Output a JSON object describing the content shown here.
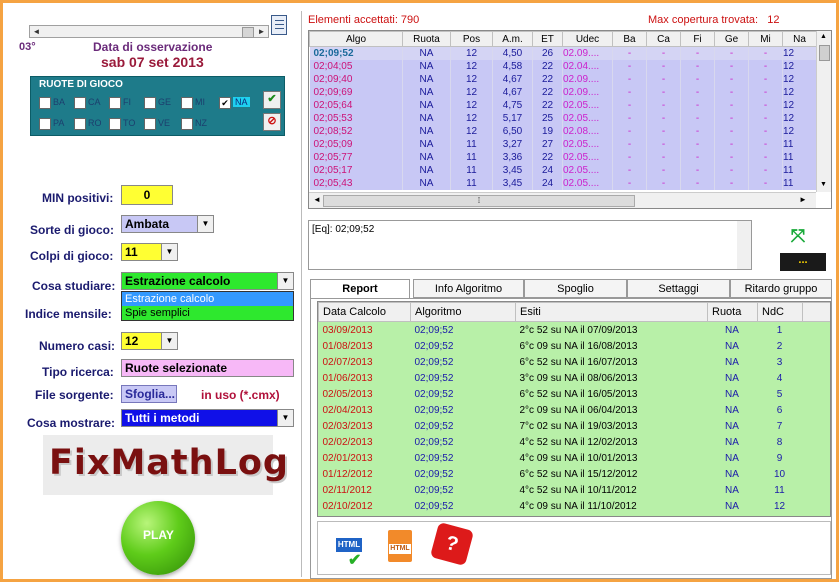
{
  "left": {
    "issue": "03°",
    "date_label": "Data di osservazione",
    "date_value": "sab 07 set 2013",
    "ruote_title": "RUOTE DI GIOCO",
    "ruote_row1": [
      "BA",
      "CA",
      "FI",
      "GE",
      "MI",
      "NA"
    ],
    "ruote_row2": [
      "PA",
      "RO",
      "TO",
      "VE",
      "NZ"
    ],
    "min_positivi_label": "MIN positivi:",
    "min_positivi_value": "0",
    "sorte_label": "Sorte di gioco:",
    "sorte_value": "Ambata",
    "colpi_label": "Colpi di gioco:",
    "colpi_value": "11",
    "cosa_studiare_label": "Cosa studiare:",
    "cosa_studiare_value": "Estrazione calcolo",
    "cosa_studiare_options": [
      "Estrazione calcolo",
      "Spie semplici"
    ],
    "indice_label": "Indice mensile:",
    "numero_casi_label": "Numero casi:",
    "numero_casi_value": "12",
    "tipo_ricerca_label": "Tipo ricerca:",
    "tipo_ricerca_value": "Ruote selezionate",
    "file_label": "File sorgente:",
    "file_button": "Sfoglia...",
    "file_status": "in uso (*.cmx)",
    "mostrare_label": "Cosa mostrare:",
    "mostrare_value": "Tutti i metodi",
    "logo_text": "FixMathLog",
    "play_label": "PLAY"
  },
  "top": {
    "accepted": "Elementi accettati: 790",
    "max_cov": "Max copertura trovata:   12",
    "columns": [
      "Algo",
      "Ruota",
      "Pos",
      "A.m.",
      "ET",
      "Udec",
      "Ba",
      "Ca",
      "Fi",
      "Ge",
      "Mi",
      "Na"
    ],
    "rows": [
      [
        "02;09;52",
        "NA",
        "12",
        "4,50",
        "26",
        "02.09...."
      ],
      [
        "02;04;05",
        "NA",
        "12",
        "4,58",
        "22",
        "02.04...."
      ],
      [
        "02;09;40",
        "NA",
        "12",
        "4,67",
        "22",
        "02.09...."
      ],
      [
        "02;09;69",
        "NA",
        "12",
        "4,67",
        "22",
        "02.09...."
      ],
      [
        "02;05;64",
        "NA",
        "12",
        "4,75",
        "22",
        "02.05...."
      ],
      [
        "02;05;53",
        "NA",
        "12",
        "5,17",
        "25",
        "02.05...."
      ],
      [
        "02;08;52",
        "NA",
        "12",
        "6,50",
        "19",
        "02.08...."
      ],
      [
        "02;05;09",
        "NA",
        "11",
        "3,27",
        "27",
        "02.05...."
      ],
      [
        "02;05;77",
        "NA",
        "11",
        "3,36",
        "22",
        "02.05...."
      ],
      [
        "02;05;17",
        "NA",
        "11",
        "3,45",
        "24",
        "02.05...."
      ],
      [
        "02;05;43",
        "NA",
        "11",
        "3,45",
        "24",
        "02.05...."
      ]
    ],
    "row_tail": [
      "12",
      "12",
      "12",
      "12",
      "12",
      "12",
      "12",
      "11",
      "11",
      "11",
      "11"
    ],
    "dash": "-"
  },
  "formula": "[Eq]: 02;09;52",
  "dots_button": "...",
  "tabs": [
    "Report",
    "Info Algoritmo",
    "Spoglio",
    "Settaggi",
    "Ritardo gruppo"
  ],
  "report": {
    "columns": [
      "Data Calcolo",
      "Algoritmo",
      "Esiti",
      "Ruota",
      "NdC"
    ],
    "rows": [
      [
        "03/09/2013",
        "02;09;52",
        "2°c 52 su NA il 07/09/2013",
        "NA",
        "1"
      ],
      [
        "01/08/2013",
        "02;09;52",
        "6°c 09 su NA il 16/08/2013",
        "NA",
        "2"
      ],
      [
        "02/07/2013",
        "02;09;52",
        "6°c 52 su NA il 16/07/2013",
        "NA",
        "3"
      ],
      [
        "01/06/2013",
        "02;09;52",
        "3°c 09 su NA il 08/06/2013",
        "NA",
        "4"
      ],
      [
        "02/05/2013",
        "02;09;52",
        "6°c 52 su NA il 16/05/2013",
        "NA",
        "5"
      ],
      [
        "02/04/2013",
        "02;09;52",
        "2°c 09 su NA il 06/04/2013",
        "NA",
        "6"
      ],
      [
        "02/03/2013",
        "02;09;52",
        "7°c 02 su NA il 19/03/2013",
        "NA",
        "7"
      ],
      [
        "02/02/2013",
        "02;09;52",
        "4°c 52 su NA il 12/02/2013",
        "NA",
        "8"
      ],
      [
        "02/01/2013",
        "02;09;52",
        "4°c 09 su NA il 10/01/2013",
        "NA",
        "9"
      ],
      [
        "01/12/2012",
        "02;09;52",
        "6°c 52 su NA il 15/12/2012",
        "NA",
        "10"
      ],
      [
        "02/11/2012",
        "02;09;52",
        "4°c 52 su NA il 10/11/2012",
        "NA",
        "11"
      ],
      [
        "02/10/2012",
        "02;09;52",
        "4°c 09 su NA il 11/10/2012",
        "NA",
        "12"
      ]
    ]
  },
  "bottom_icons": [
    "HTML",
    "HTML"
  ],
  "colors": {
    "accent": "#f5a342",
    "green": "#2ee82e",
    "yellow": "#ffff33",
    "lilac": "#c8c8f5",
    "pink": "#f7b8f7",
    "blue": "#1010e8",
    "grid_green": "#b8f0a8"
  }
}
